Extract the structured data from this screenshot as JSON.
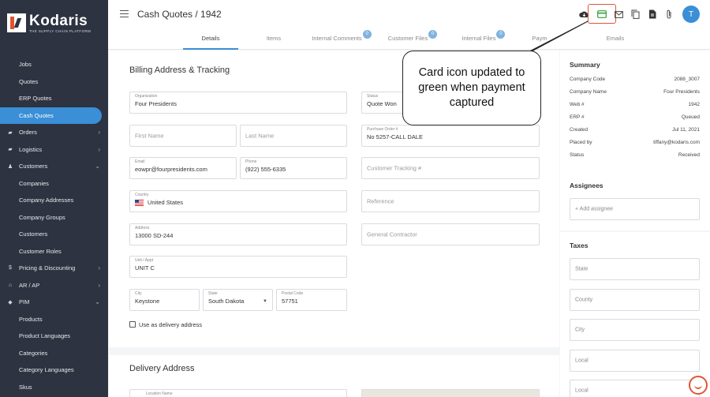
{
  "brand": {
    "name": "Kodaris",
    "tagline": "THE SUPPLY CHAIN PLATFORM"
  },
  "sidebar": {
    "items": [
      {
        "label": "Jobs",
        "type": "sub"
      },
      {
        "label": "Quotes",
        "type": "sub"
      },
      {
        "label": "ERP Quotes",
        "type": "sub"
      },
      {
        "label": "Cash Quotes",
        "type": "sub",
        "active": true
      },
      {
        "label": "Orders",
        "type": "top",
        "icon": "truck-icon",
        "chevron": "›"
      },
      {
        "label": "Logistics",
        "type": "top",
        "icon": "truck-icon",
        "chevron": "›"
      },
      {
        "label": "Customers",
        "type": "top",
        "icon": "users-icon",
        "chevron": "⌄"
      },
      {
        "label": "Companies",
        "type": "sub"
      },
      {
        "label": "Company Addresses",
        "type": "sub"
      },
      {
        "label": "Company Groups",
        "type": "sub"
      },
      {
        "label": "Customers",
        "type": "sub"
      },
      {
        "label": "Customer Roles",
        "type": "sub"
      },
      {
        "label": "Pricing & Discounting",
        "type": "top",
        "icon": "dollar-icon",
        "chevron": "›"
      },
      {
        "label": "AR / AP",
        "type": "top",
        "icon": "bank-icon",
        "chevron": "›"
      },
      {
        "label": "PIM",
        "type": "top",
        "icon": "tag-icon",
        "chevron": "⌄"
      },
      {
        "label": "Products",
        "type": "sub"
      },
      {
        "label": "Product Languages",
        "type": "sub"
      },
      {
        "label": "Categories",
        "type": "sub"
      },
      {
        "label": "Category Languages",
        "type": "sub"
      },
      {
        "label": "Skus",
        "type": "sub"
      }
    ]
  },
  "header": {
    "title": "Cash Quotes / 1942",
    "avatar_initial": "T",
    "tabs": [
      {
        "label": "Details",
        "badge": ""
      },
      {
        "label": "Items",
        "badge": ""
      },
      {
        "label": "Internal Comments",
        "badge": "0"
      },
      {
        "label": "Customer Files",
        "badge": "0"
      },
      {
        "label": "Internal Files",
        "badge": "0"
      },
      {
        "label": "Paym",
        "badge": ""
      },
      {
        "label": "Emails",
        "badge": ""
      }
    ],
    "card_icon_color": "#2e9d3a"
  },
  "billing": {
    "title": "Billing Address & Tracking",
    "organization_label": "Organization",
    "organization": "Four Presidents",
    "status_label": "Status",
    "status": "Quote Won",
    "first_name_placeholder": "First Name",
    "last_name_placeholder": "Last Name",
    "po_label": "Purchase Order #",
    "po": "No 5257-CALL DALE",
    "email_label": "Email",
    "email": "eowpr@fourpresidents.com",
    "phone_label": "Phone",
    "phone": "(922) 555-6335",
    "customer_tracking_placeholder": "Customer Tracking #",
    "country_label": "Country",
    "country": "United States",
    "reference_placeholder": "Reference",
    "address_label": "Address",
    "address": "13000 SD-244",
    "general_contractor_placeholder": "General Contractor",
    "unit_label": "Unit / Appt",
    "unit": "UNIT C",
    "city_label": "City",
    "city": "Keystone",
    "state_label": "State",
    "state": "South Dakota",
    "postal_label": "Postal Code",
    "postal": "57751",
    "delivery_checkbox_label": "Use as delivery address"
  },
  "delivery": {
    "title": "Delivery Address",
    "location_label": "Location Name"
  },
  "summary": {
    "title": "Summary",
    "rows": [
      {
        "key": "Company Code",
        "value": "2088_3007"
      },
      {
        "key": "Company Name",
        "value": "Four Presidents"
      },
      {
        "key": "Web #",
        "value": "1942"
      },
      {
        "key": "ERP #",
        "value": "Queued"
      },
      {
        "key": "Created",
        "value": "Jul 11, 2021"
      },
      {
        "key": "Placed by",
        "value": "tiffany@kodaris.com"
      },
      {
        "key": "Status",
        "value": "Received"
      }
    ]
  },
  "assignees": {
    "title": "Assignees",
    "add_label": "+ Add assignee"
  },
  "taxes": {
    "title": "Taxes",
    "fields": [
      "State",
      "County",
      "City",
      "Local",
      "Local"
    ]
  },
  "callout": {
    "text": "Card icon updated to green when payment captured"
  }
}
